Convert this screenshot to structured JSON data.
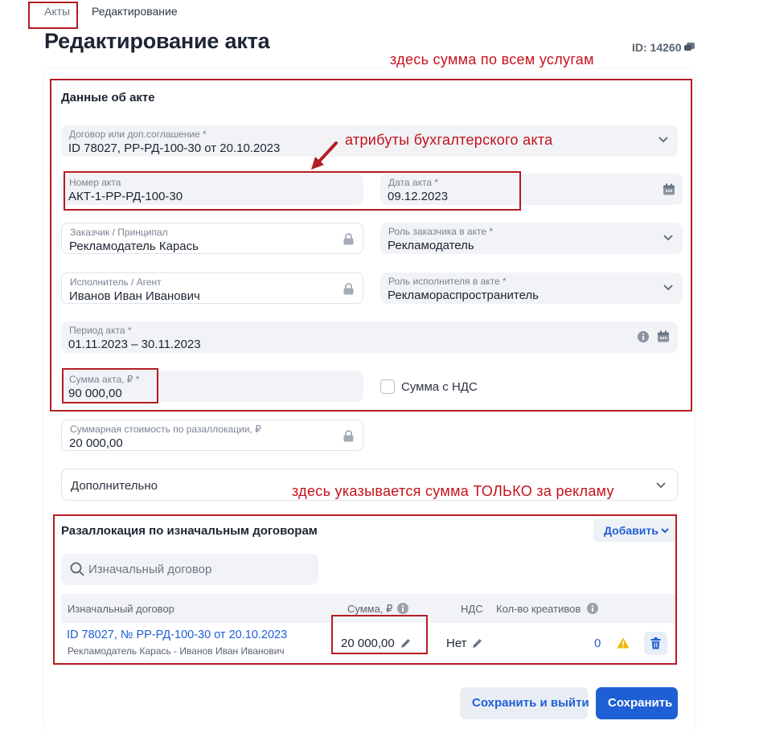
{
  "breadcrumb": {
    "acts": "Акты",
    "current": "Редактирование"
  },
  "page": {
    "title": "Редактирование акта",
    "id_label": "ID: 14260"
  },
  "act_section": {
    "title": "Данные об акте",
    "contract": {
      "label": "Договор или доп.соглашение *",
      "value": "ID 78027, РР-РД-100-30 от 20.10.2023"
    },
    "act_number": {
      "label": "Номер акта",
      "value": "АКТ-1-РР-РД-100-30"
    },
    "act_date": {
      "label": "Дата акта *",
      "value": "09.12.2023"
    },
    "customer": {
      "label": "Заказчик / Принципал",
      "value": "Рекламодатель Карась"
    },
    "customer_role": {
      "label": "Роль заказчика в акте *",
      "value": "Рекламодатель"
    },
    "executor": {
      "label": "Исполнитель / Агент",
      "value": "Иванов Иван Иванович"
    },
    "executor_role": {
      "label": "Роль исполнителя в акте *",
      "value": "Рекламораспространитель"
    },
    "period": {
      "label": "Период акта *",
      "value": "01.11.2023 – 30.11.2023"
    },
    "amount": {
      "label": "Сумма акта, ₽ *",
      "value": "90 000,00"
    },
    "vat_checkbox_label": "Сумма с НДС",
    "vat_checked": false
  },
  "realloc_total": {
    "label": "Суммарная стоимость по разаллокации, ₽",
    "value": "20 000,00"
  },
  "additional": {
    "label": "Дополнительно"
  },
  "realloc_section": {
    "title": "Разаллокация по изначальным договорам",
    "add_button": "Добавить",
    "search_placeholder": "Изначальный договор",
    "columns": {
      "contract": "Изначальный договор",
      "amount": "Сумма, ₽",
      "vat": "НДС",
      "creatives": "Кол-во креативов"
    },
    "rows": [
      {
        "contract": "ID 78027, № РР-РД-100-30 от 20.10.2023",
        "parties": "Рекламодатель Карась - Иванов Иван Иванович",
        "amount": "20 000,00",
        "vat": "Нет",
        "creatives": "0"
      }
    ]
  },
  "actions": {
    "save_exit": "Сохранить и выйти",
    "save": "Сохранить"
  },
  "annotations": {
    "note_total": "здесь сумма по всем услугам",
    "note_attrs": "атрибуты бухгалтерского акта",
    "note_ads": "здесь указывается сумма ТОЛЬКО за рекламу"
  },
  "colors": {
    "accent": "#1f5fd6",
    "annotation": "#b51c24",
    "warning": "#f2b705",
    "field_bg": "#f1f3f6"
  },
  "icons": [
    "chevron-right-icon",
    "comment-icon",
    "chevron-down-icon",
    "calendar-icon",
    "lock-icon",
    "info-icon",
    "search-icon",
    "pencil-icon",
    "warning-icon",
    "trash-icon",
    "arrow-icon"
  ]
}
